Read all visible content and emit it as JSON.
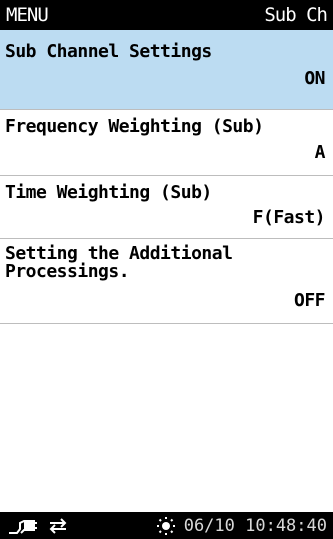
{
  "header": {
    "title": "MENU",
    "section": "Sub Ch"
  },
  "items": [
    {
      "label": "Sub Channel Settings",
      "value": "ON",
      "selected": true
    },
    {
      "label": "Frequency Weighting (Sub)",
      "value": "A",
      "selected": false
    },
    {
      "label": "Time Weighting (Sub)",
      "value": "F(Fast)",
      "selected": false
    },
    {
      "label": "Setting the Additional\nProcessings.",
      "value": "OFF",
      "selected": false
    }
  ],
  "status": {
    "datetime": "06/10 10:48:40",
    "icons": [
      "plug-icon",
      "transfer-arrows-icon",
      "sun-icon"
    ]
  }
}
